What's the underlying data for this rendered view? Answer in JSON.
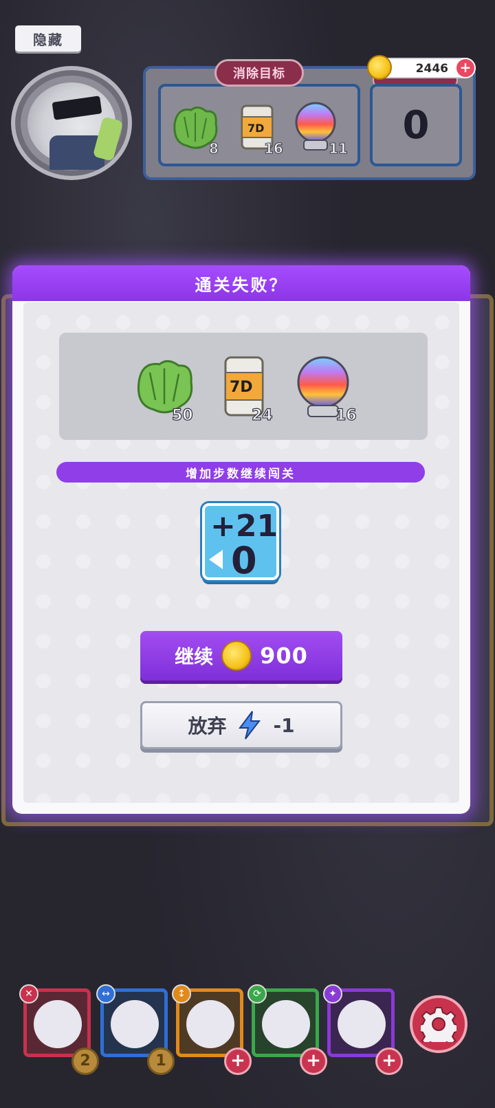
{
  "top": {
    "hide_label": "隐藏",
    "coins": "2446",
    "goal_title": "消除目标",
    "steps_remaining": "0",
    "goals": [
      {
        "name": "leaf",
        "count": "8"
      },
      {
        "name": "can",
        "count": "16"
      },
      {
        "name": "orb",
        "count": "11"
      }
    ]
  },
  "dialog": {
    "title": "通关失败？",
    "items": [
      {
        "name": "leaf",
        "count": "50"
      },
      {
        "name": "can",
        "count": "24"
      },
      {
        "name": "orb",
        "count": "16"
      }
    ],
    "ribbon": "增加步数继续闯关",
    "step_card": {
      "top": "+21",
      "bottom": "0"
    },
    "continue": {
      "label": "继续",
      "price": "900"
    },
    "giveup": {
      "label": "放弃",
      "cost": "-1"
    }
  },
  "party": [
    {
      "name": "hero-1",
      "color": "#c8324c",
      "badge": "2",
      "type": "plus"
    },
    {
      "name": "hero-2",
      "color": "#2f6fd6",
      "badge": "1",
      "type": "number"
    },
    {
      "name": "hero-3",
      "color": "#e08a1c",
      "badge": "+",
      "type": "plus"
    },
    {
      "name": "hero-4",
      "color": "#3aa84a",
      "badge": "+",
      "type": "plus"
    },
    {
      "name": "hero-5",
      "color": "#8a3ad6",
      "badge": "+",
      "type": "plus"
    }
  ],
  "colors": {
    "accent_purple": "#8f3ee8",
    "step_blue": "#5fc2ee",
    "coin_gold": "#f5c21a",
    "danger_red": "#c8324c"
  }
}
